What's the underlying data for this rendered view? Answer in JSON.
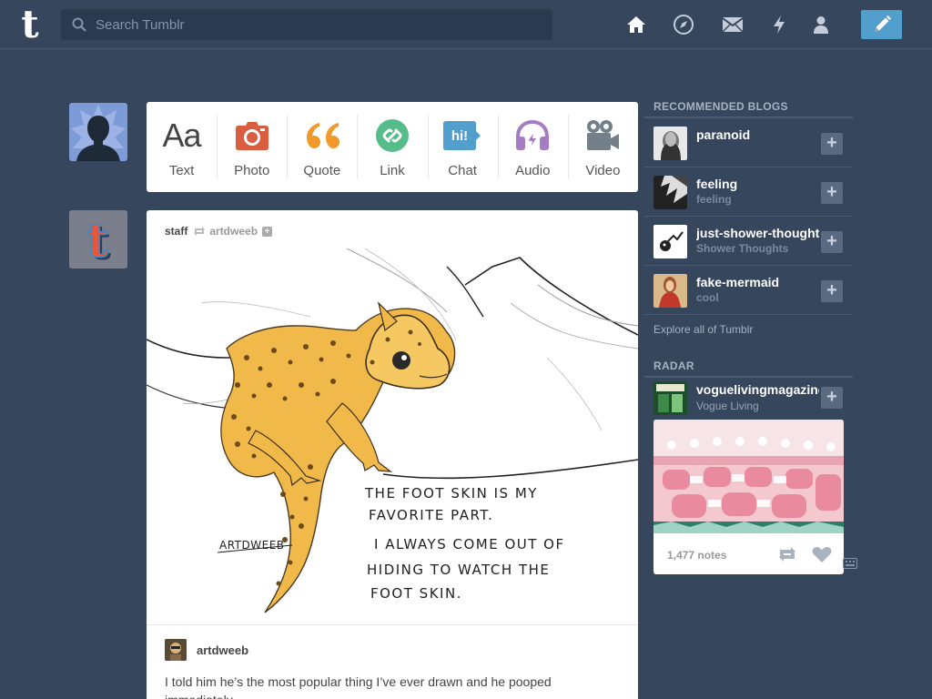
{
  "header": {
    "logo": "t",
    "search_placeholder": "Search Tumblr",
    "icons": [
      "home-icon",
      "explore-icon",
      "mail-icon",
      "activity-icon",
      "account-icon",
      "compose-icon"
    ]
  },
  "post_types": [
    {
      "label": "Text",
      "icon": "text-icon",
      "color": "#444444"
    },
    {
      "label": "Photo",
      "icon": "camera-icon",
      "color": "#d95e40"
    },
    {
      "label": "Quote",
      "icon": "quote-icon",
      "color": "#f2992e"
    },
    {
      "label": "Link",
      "icon": "link-icon",
      "color": "#56bc8a"
    },
    {
      "label": "Chat",
      "icon": "chat-icon",
      "color": "#529ecc"
    },
    {
      "label": "Audio",
      "icon": "headphones-icon",
      "color": "#a77dc2"
    },
    {
      "label": "Video",
      "icon": "video-camera-icon",
      "color": "#748089"
    }
  ],
  "post": {
    "author": "staff",
    "reblogged_from": "artdweeb",
    "art_text": {
      "signature": "ARTDWEEB",
      "lines": [
        "THE  FOOT SKIN  IS  MY",
        "FAVORITE  PART.",
        "I  ALWAYS  COME  OUT OF",
        "HIDING  TO  WATCH  THE",
        "FOOT  SKIN."
      ]
    },
    "reblog_user": "artdweeb",
    "caption": "I told him he’s the most popular thing I’ve ever drawn and he pooped immediately."
  },
  "sidebar": {
    "recommended_title": "RECOMMENDED BLOGS",
    "blogs": [
      {
        "name": "paranoid",
        "subtitle": ""
      },
      {
        "name": "feeling",
        "subtitle": "feeling"
      },
      {
        "name": "just-shower-thoughts",
        "subtitle": "Shower Thoughts"
      },
      {
        "name": "fake-mermaid",
        "subtitle": "cool"
      }
    ],
    "explore": "Explore all of Tumblr",
    "radar_title": "RADAR",
    "radar": {
      "name": "voguelivingmagazine",
      "subtitle": "Vogue Living",
      "notes": "1,477 notes"
    }
  },
  "colors": {
    "background": "#36465d",
    "compose": "#529ecc",
    "search_bg": "#2b3a4e"
  }
}
